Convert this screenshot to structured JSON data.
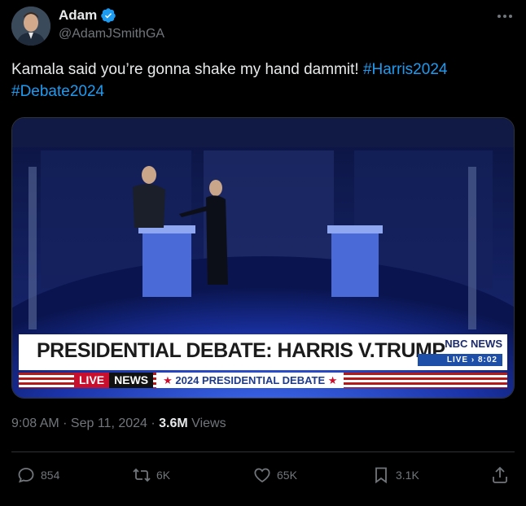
{
  "author": {
    "name": "Adam",
    "handle": "@AdamJSmithGA"
  },
  "tweet": {
    "text": "Kamala said you’re gonna shake my hand dammit! ",
    "hashtag1": "#Harris2024",
    "hashtag2": "#Debate2024"
  },
  "media": {
    "lower_third_title": "PRESIDENTIAL DEBATE: HARRIS V.TRUMP",
    "network": "NBC NEWS",
    "live_badge": "LIVE › 8:02",
    "abc_live": "LIVE",
    "abc_news": "NEWS",
    "abc_debate": "2024 PRESIDENTIAL DEBATE",
    "star": "★"
  },
  "meta": {
    "time": "9:08 AM",
    "sep": " · ",
    "date": "Sep 11, 2024",
    "views_count": "3.6M",
    "views_label": " Views"
  },
  "actions": {
    "replies": "854",
    "reposts": "6K",
    "likes": "65K",
    "bookmarks": "3.1K"
  },
  "colors": {
    "accent": "#1d9bf0",
    "muted": "#71767b",
    "background": "#000000"
  }
}
